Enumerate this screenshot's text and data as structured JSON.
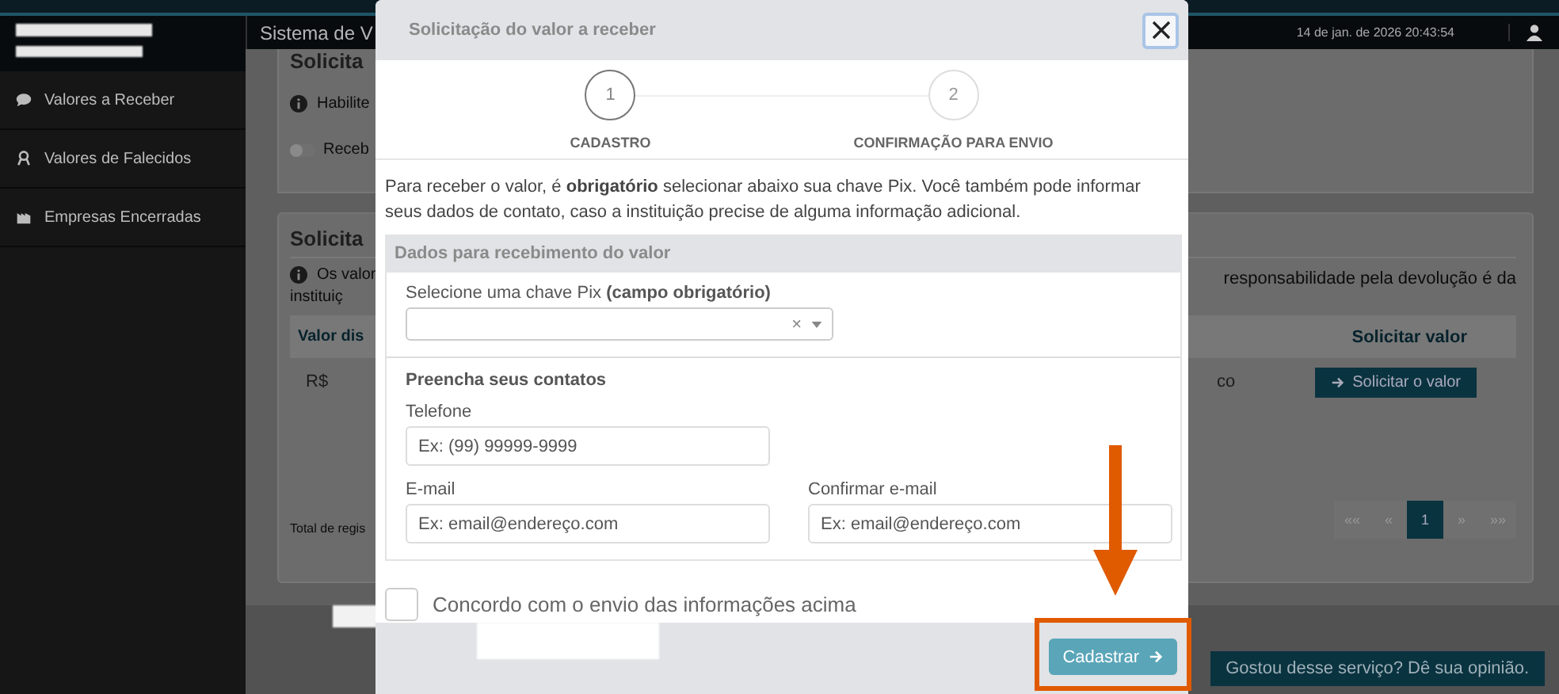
{
  "header": {
    "title": "Sistema de V",
    "datetime": "14 de jan. de 2026 20:43:54"
  },
  "sidebar": {
    "items": [
      {
        "label": "Valores a Receber"
      },
      {
        "label": "Valores de Falecidos"
      },
      {
        "label": "Empresas Encerradas"
      }
    ]
  },
  "section_1": {
    "title": "Solicita",
    "info": "Habilite",
    "toggle_label": "Receb",
    "toggle_on": false
  },
  "section_2": {
    "title": "Solicita",
    "info_left": "Os valor",
    "info_left_2": "instituiç",
    "info_right": "responsabilidade pela devolução é da",
    "columns": [
      "Valor dis",
      "Solicitar valor"
    ],
    "row": {
      "cell_1": "R$",
      "cell_2": "co",
      "button": "Solicitar o valor"
    },
    "total": "Total de regis",
    "pagination": [
      {
        "label": "««",
        "selected": false
      },
      {
        "label": "«",
        "selected": false
      },
      {
        "label": "1",
        "selected": true
      },
      {
        "label": "»",
        "selected": false
      },
      {
        "label": "»»",
        "selected": false
      }
    ]
  },
  "feedback_button": "Gostou desse serviço? Dê sua opinião.",
  "modal": {
    "title": "Solicitação do valor a receber",
    "steps": [
      {
        "number": "1",
        "label": "CADASTRO",
        "selected": true
      },
      {
        "number": "2",
        "label": "CONFIRMAÇÃO PARA ENVIO",
        "selected": false
      }
    ],
    "intro": "Para receber o valor, é **obrigatório** selecionar abaixo sua chave Pix. Você também pode informar seus dados de contato, caso a instituição precise de alguma informação adicional.",
    "section_title": "Dados para recebimento do valor",
    "pix_label": "Selecione uma chave Pix **(campo obrigatório)**",
    "pix_clear": "×",
    "contacts_title": "Preencha seus contatos",
    "fields": [
      {
        "label": "Telefone",
        "placeholder": "Ex: (99) 99999-9999"
      },
      {
        "label": "E-mail",
        "placeholder": "Ex: email@endereço.com"
      },
      {
        "label": "Confirmar e-mail",
        "placeholder": "Ex: email@endereço.com"
      }
    ],
    "agree": {
      "label": "Concordo com o envio das informações acima",
      "checked": false
    },
    "submit": "Cadastrar"
  }
}
